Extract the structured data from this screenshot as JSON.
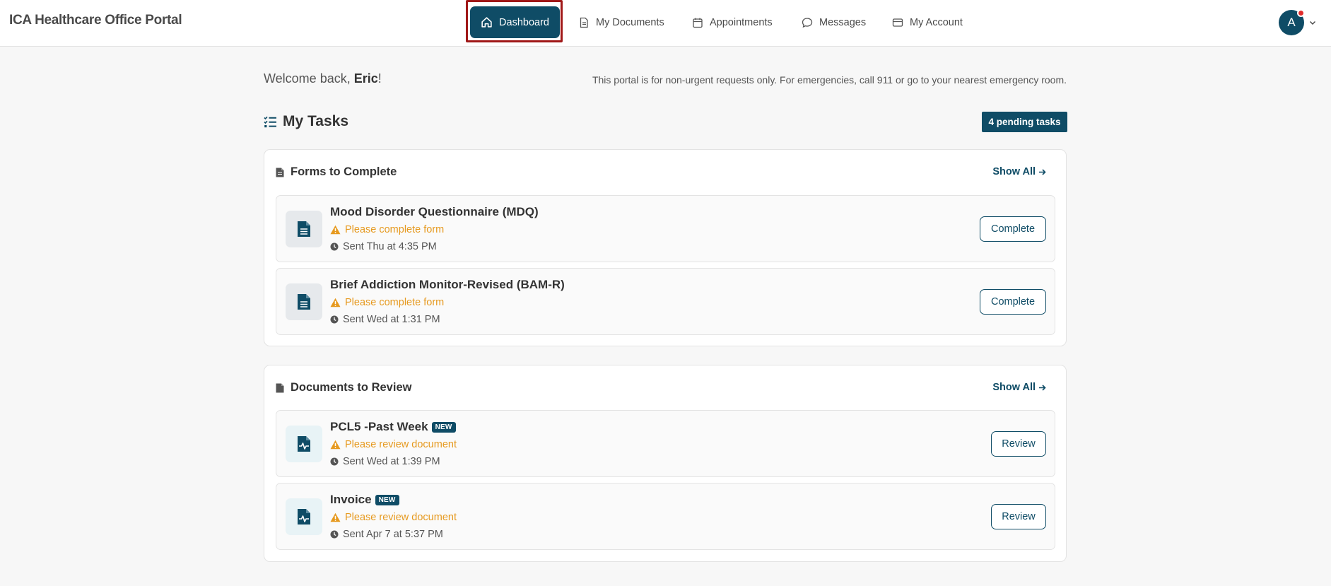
{
  "brand": "ICA Healthcare Office Portal",
  "nav": {
    "dashboard": "Dashboard",
    "documents": "My Documents",
    "appointments": "Appointments",
    "messages": "Messages",
    "account": "My Account"
  },
  "user": {
    "initial": "A",
    "has_notification": true
  },
  "welcome": {
    "prefix": "Welcome back, ",
    "name": "Eric",
    "suffix": "!"
  },
  "notice": "This portal is for non-urgent requests only. For emergencies, call 911 or go to your nearest emergency room.",
  "tasks": {
    "title": "My Tasks",
    "pending_label": "4 pending tasks"
  },
  "forms": {
    "title": "Forms to Complete",
    "show_all": "Show All",
    "items": [
      {
        "title": "Mood Disorder Questionnaire (MDQ)",
        "status": "Please complete form",
        "sent": "Sent Thu at 4:35 PM",
        "action": "Complete"
      },
      {
        "title": "Brief Addiction Monitor-Revised (BAM-R)",
        "status": "Please complete form",
        "sent": "Sent Wed at 1:31 PM",
        "action": "Complete"
      }
    ]
  },
  "documents": {
    "title": "Documents to Review",
    "show_all": "Show All",
    "items": [
      {
        "title": "PCL5 -Past Week",
        "badge": "NEW",
        "status": "Please review document",
        "sent": "Sent Wed at 1:39 PM",
        "action": "Review"
      },
      {
        "title": "Invoice",
        "badge": "NEW",
        "status": "Please review document",
        "sent": "Sent Apr 7 at 5:37 PM",
        "action": "Review"
      }
    ]
  },
  "colors": {
    "primary": "#0f4c66",
    "warning": "#e6991e",
    "highlight": "#a01818",
    "notification": "#e12b2b"
  }
}
